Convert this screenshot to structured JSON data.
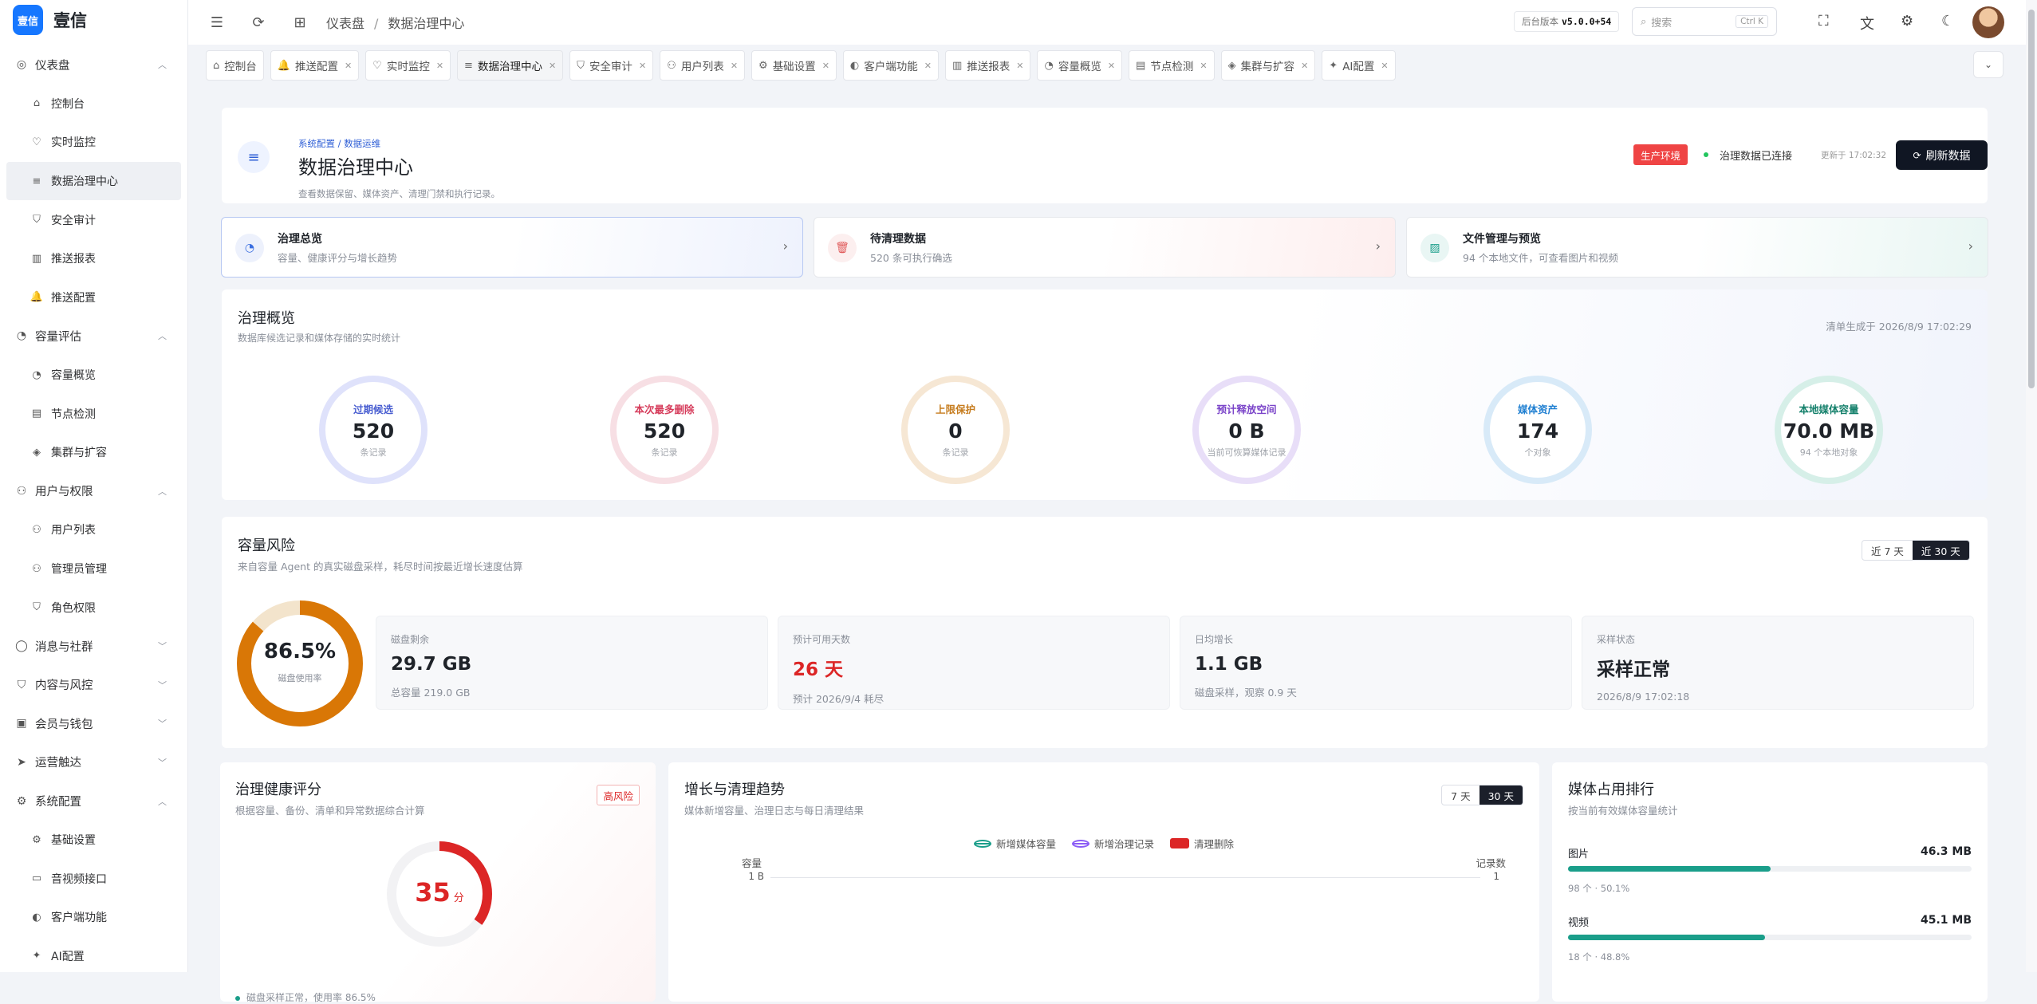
{
  "app": {
    "logo_mark": "壹信",
    "name": "壹信"
  },
  "sidebar": {
    "groups": [
      {
        "label": "仪表盘",
        "icon": "dashboard-icon",
        "expanded": true,
        "children": [
          {
            "label": "控制台",
            "icon": "home-icon",
            "active": false
          },
          {
            "label": "实时监控",
            "icon": "heart-pulse-icon",
            "active": false
          },
          {
            "label": "数据治理中心",
            "icon": "database-icon",
            "active": true
          },
          {
            "label": "安全审计",
            "icon": "shield-icon",
            "active": false
          },
          {
            "label": "推送报表",
            "icon": "bar-chart-icon",
            "active": false
          },
          {
            "label": "推送配置",
            "icon": "bell-icon",
            "active": false
          }
        ]
      },
      {
        "label": "容量评估",
        "icon": "gauge-icon",
        "expanded": true,
        "children": [
          {
            "label": "容量概览",
            "icon": "gauge-icon"
          },
          {
            "label": "节点检测",
            "icon": "server-icon"
          },
          {
            "label": "集群与扩容",
            "icon": "layers-icon"
          }
        ]
      },
      {
        "label": "用户与权限",
        "icon": "user-icon",
        "expanded": true,
        "children": [
          {
            "label": "用户列表",
            "icon": "users-icon"
          },
          {
            "label": "管理员管理",
            "icon": "user-cog-icon"
          },
          {
            "label": "角色权限",
            "icon": "shield-lock-icon"
          }
        ]
      },
      {
        "label": "消息与社群",
        "icon": "message-icon",
        "expanded": false,
        "children": []
      },
      {
        "label": "内容与风控",
        "icon": "shield-check-icon",
        "expanded": false,
        "children": []
      },
      {
        "label": "会员与钱包",
        "icon": "wallet-icon",
        "expanded": false,
        "children": []
      },
      {
        "label": "运营触达",
        "icon": "send-icon",
        "expanded": false,
        "children": []
      },
      {
        "label": "系统配置",
        "icon": "gear-icon",
        "expanded": true,
        "children": [
          {
            "label": "基础设置",
            "icon": "gear-icon"
          },
          {
            "label": "音视频接口",
            "icon": "video-icon"
          },
          {
            "label": "客户端功能",
            "icon": "toggle-icon"
          },
          {
            "label": "AI配置",
            "icon": "ai-icon"
          }
        ]
      }
    ]
  },
  "header": {
    "breadcrumb": [
      "仪表盘",
      "数据治理中心"
    ],
    "version_label": "后台版本",
    "version": "v5.0.0+54",
    "search_placeholder": "搜索",
    "search_shortcut": "Ctrl K"
  },
  "tabs": [
    {
      "label": "控制台",
      "icon": "home-icon",
      "closable": false
    },
    {
      "label": "推送配置",
      "icon": "bell-icon",
      "closable": true
    },
    {
      "label": "实时监控",
      "icon": "heart-pulse-icon",
      "closable": true
    },
    {
      "label": "数据治理中心",
      "icon": "database-icon",
      "closable": true,
      "active": true
    },
    {
      "label": "安全审计",
      "icon": "shield-icon",
      "closable": true
    },
    {
      "label": "用户列表",
      "icon": "users-icon",
      "closable": true
    },
    {
      "label": "基础设置",
      "icon": "gear-icon",
      "closable": true
    },
    {
      "label": "客户端功能",
      "icon": "toggle-icon",
      "closable": true
    },
    {
      "label": "推送报表",
      "icon": "bar-chart-icon",
      "closable": true
    },
    {
      "label": "容量概览",
      "icon": "gauge-icon",
      "closable": true
    },
    {
      "label": "节点检测",
      "icon": "server-icon",
      "closable": true
    },
    {
      "label": "集群与扩容",
      "icon": "layers-icon",
      "closable": true
    },
    {
      "label": "AI配置",
      "icon": "ai-icon",
      "closable": true
    }
  ],
  "page": {
    "crumb_a": "系统配置",
    "crumb_b": "数据运维",
    "title": "数据治理中心",
    "subtitle": "查看数据保留、媒体资产、清理门禁和执行记录。",
    "env_badge": "生产环境",
    "conn_status": "治理数据已连接",
    "updated": "更新于 17:02:32",
    "refresh": "刷新数据"
  },
  "quick_cards": [
    {
      "title": "治理总览",
      "desc": "容量、健康评分与增长趋势",
      "icon": "gauge-icon",
      "accent": "#3b6fe0"
    },
    {
      "title": "待清理数据",
      "desc": "520 条可执行确选",
      "icon": "trash-icon",
      "accent": "#e05a5a"
    },
    {
      "title": "文件管理与预览",
      "desc": "94 个本地文件，可查看图片和视频",
      "icon": "image-icon",
      "accent": "#1a9e8a"
    }
  ],
  "overview": {
    "title": "治理概览",
    "subtitle": "数据库候选记录和媒体存储的实时统计",
    "generated": "清单生成于 2026/8/9 17:02:29",
    "items": [
      {
        "label": "过期候选",
        "value": "520",
        "sub": "条记录",
        "color": "#4a5fd1",
        "ring": "#dfe2fb"
      },
      {
        "label": "本次最多删除",
        "value": "520",
        "sub": "条记录",
        "color": "#d63c5b",
        "ring": "#f7dfe4"
      },
      {
        "label": "上限保护",
        "value": "0",
        "sub": "条记录",
        "color": "#c67c1e",
        "ring": "#f6e7d4"
      },
      {
        "label": "预计释放空间",
        "value": "0 B",
        "sub": "当前可恢算媒体记录",
        "color": "#7b45c9",
        "ring": "#e8def8"
      },
      {
        "label": "媒体资产",
        "value": "174",
        "sub": "个对象",
        "color": "#1f7fd1",
        "ring": "#d8eaf8"
      },
      {
        "label": "本地媒体容量",
        "value": "70.0 MB",
        "sub": "94 个本地对象",
        "color": "#14806b",
        "ring": "#d6efe8"
      }
    ]
  },
  "capacity": {
    "title": "容量风险",
    "subtitle": "来自容量 Agent 的真实磁盘采样，耗尽时间按最近增长速度估算",
    "range_options": [
      "近 7 天",
      "近 30 天"
    ],
    "range_selected": 1,
    "usage_percent": 86.5,
    "usage_value": "86.5%",
    "usage_label": "磁盘使用率",
    "usage_color": "#d97706",
    "metrics": [
      {
        "label": "磁盘剩余",
        "value": "29.7 GB",
        "sub": "总容量 219.0 GB",
        "highlight": false
      },
      {
        "label": "预计可用天数",
        "value": "26 天",
        "sub": "预计 2026/9/4 耗尽",
        "highlight": true
      },
      {
        "label": "日均增长",
        "value": "1.1 GB",
        "sub": "磁盘采样，观察 0.9 天",
        "highlight": false
      },
      {
        "label": "采样状态",
        "value": "采样正常",
        "sub": "2026/8/9 17:02:18",
        "highlight": false
      }
    ]
  },
  "health": {
    "title": "治理健康评分",
    "subtitle": "根据容量、备份、清单和异常数据综合计算",
    "badge": "高风险",
    "score": 35,
    "score_max": 100,
    "unit": "分",
    "note": "磁盘采样正常，使用率 86.5%"
  },
  "trend": {
    "title": "增长与清理趋势",
    "subtitle": "媒体新增容量、治理日志与每日清理结果",
    "range_options": [
      "7 天",
      "30 天"
    ],
    "range_selected": 1,
    "legend": [
      "新增媒体容量",
      "新增治理记录",
      "清理删除"
    ],
    "legend_colors": [
      "#1a9e8a",
      "#8b5cf6",
      "#dc2626"
    ],
    "left_axis": "容量",
    "right_axis": "记录数",
    "left_tick": "1 B",
    "right_tick": "1"
  },
  "media_rank": {
    "title": "媒体占用排行",
    "subtitle": "按当前有效媒体容量统计",
    "items": [
      {
        "label": "图片",
        "value": "46.3 MB",
        "meta": "98 个 · 50.1%",
        "pct": 50.1
      },
      {
        "label": "视频",
        "value": "45.1 MB",
        "meta": "18 个 · 48.8%",
        "pct": 48.8
      }
    ]
  }
}
